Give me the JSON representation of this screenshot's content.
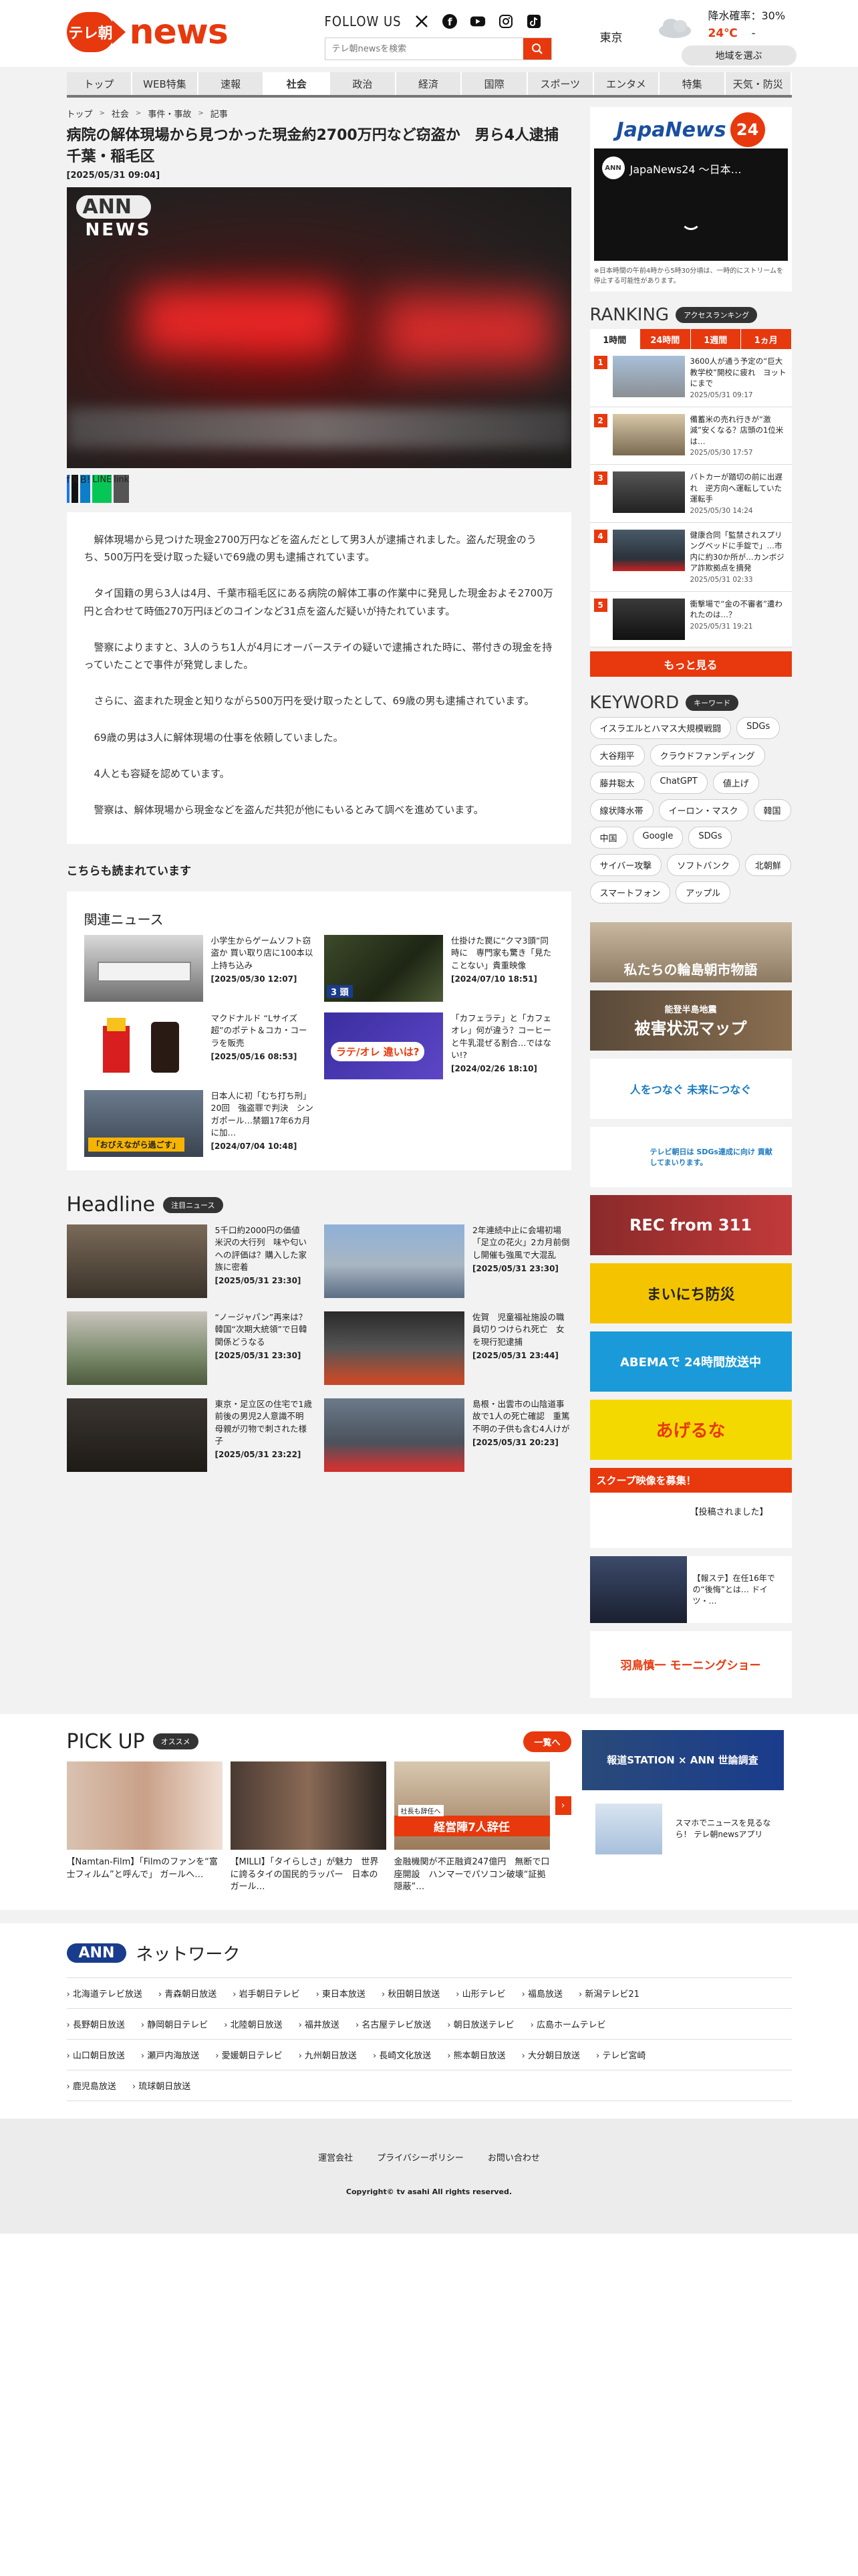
{
  "brand": {
    "logo_badge": "テレ朝",
    "logo_word": "news"
  },
  "follow": {
    "label": "FOLLOW US",
    "icons": [
      "x-icon",
      "facebook-icon",
      "youtube-icon",
      "instagram-icon",
      "tiktok-icon"
    ]
  },
  "search": {
    "placeholder": "テレ朝newsを検索"
  },
  "weather": {
    "city": "東京",
    "rain": "降水確率：30%",
    "temp_high": "24℃",
    "temp_low": "-",
    "region_button": "地域を選ぶ"
  },
  "nav": [
    "トップ",
    "WEB特集",
    "速報",
    "社会",
    "政治",
    "経済",
    "国際",
    "スポーツ",
    "エンタメ",
    "特集",
    "天気・防災"
  ],
  "nav_active": "社会",
  "breadcrumb": [
    "トップ",
    "社会",
    "事件・事故",
    "記事"
  ],
  "article": {
    "title": "病院の解体現場から見つかった現金約2700万円など窃盗か　男ら4人逮捕　千葉・稲毛区",
    "date": "[2025/05/31 09:04]",
    "video_ann_top": "ANN",
    "video_ann_bottom": "NEWS",
    "paragraphs": [
      "解体現場から見つけた現金2700万円などを盗んだとして男3人が逮捕されました。盗んだ現金のうち、500万円を受け取った疑いで69歳の男も逮捕されています。",
      "タイ国籍の男ら3人は4月、千葉市稲毛区にある病院の解体工事の作業中に発見した現金およそ2700万円と合わせて時価270万円ほどのコインなど31点を盗んだ疑いが持たれています。",
      "警察によりますと、3人のうち1人が4月にオーバーステイの疑いで逮捕された時に、帯付きの現金を持っていたことで事件が発覚しました。",
      "さらに、盗まれた現金と知りながら500万円を受け取ったとして、69歳の男も逮捕されています。",
      "69歳の男は3人に解体現場の仕事を依頼していました。",
      "4人とも容疑を認めています。",
      "警察は、解体現場から現金などを盗んだ共犯が他にもいるとみて調べを進めています。"
    ]
  },
  "share": [
    "f",
    "X",
    "B!",
    "LINE",
    "link"
  ],
  "more_read": "こちらも読まれています",
  "related": {
    "title": "関連ニュース",
    "items": [
      {
        "text": "小学生からゲームソフト窃盗か 買い取り店に100本以上持ち込み",
        "date": "[2025/05/30 12:07]"
      },
      {
        "text": "仕掛けた罠に“クマ3頭”同時に　専門家も驚き「見たことない」貴重映像",
        "date": "[2024/07/10 18:51]"
      },
      {
        "text": "マクドナルド “Lサイズ超”のポテト＆コカ・コーラを販売",
        "date": "[2025/05/16 08:53]"
      },
      {
        "text": "「カフェラテ」と「カフェオレ」何が違う？コーヒーと牛乳混ぜる割合…ではない!?",
        "date": "[2024/02/26 18:10]"
      },
      {
        "text": "日本人に初「むち打ち刑」20回　強盗罪で判決　シンガポール…禁錮17年6カ月に加…",
        "date": "[2024/07/04 10:48]"
      }
    ],
    "thumb_caption_4": "ラテ/オレ 違いは?",
    "thumb_caption_5": "「おびえながら過ごす」"
  },
  "headline": {
    "title": "Headline",
    "pill": "注目ニュース",
    "items": [
      {
        "text": "5千口約2000円の価値　米沢の大行列　味や匂いへの評価は？購入した家族に密着",
        "date": "[2025/05/31 23:30]"
      },
      {
        "text": "2年連続中止に会場初場　「足立の花火」2カ月前倒し開催も強風で大混乱",
        "date": "[2025/05/31 23:30]"
      },
      {
        "text": "“ノージャパン”再来は？韓国“次期大統領”で日韓関係どうなる",
        "date": "[2025/05/31 23:30]"
      },
      {
        "text": "佐賀　児童福祉施設の職員切りつけられ死亡　女を現行犯逮捕",
        "date": "[2025/05/31 23:44]"
      },
      {
        "text": "東京・足立区の住宅で1歳前後の男児2人意識不明　母親が刃物で刺された様子",
        "date": "[2025/05/31 23:22]"
      },
      {
        "text": "島根・出雲市の山陰道事故で1人の死亡確認　重篤不明の子供も含む4人けが",
        "date": "[2025/05/31 20:23]"
      }
    ]
  },
  "pickup": {
    "title": "PICK UP",
    "pill": "オススメ",
    "more": "一覧へ",
    "items": [
      {
        "text": "【Namtan-Film】「Filmのファンを“富士フィルム”と呼んで」 ガールへ…"
      },
      {
        "text": "【MILLI】「タイらしさ」が魅力　世界に誇るタイの国民的ラッパー　日本のガール…"
      },
      {
        "text": "金融機関が不正融資247億円　無断で口座開設　ハンマーでパソコン破壊“証拠隠蔽”…"
      }
    ],
    "thumb_caption_3": "経営陣7人辞任",
    "thumb_caption_3_small": "社長も辞任へ"
  },
  "sidebar": {
    "jn24_logo_text": "JapaNews",
    "jn24_logo_num": "24",
    "jn24_player_title": "JapaNews24 ～日本…",
    "jn24_player_badge": "ANN",
    "jn24_note": "※日本時間の午前4時から5時30分頃は、一時的にストリームを停止する可能性があります。",
    "ranking_title": "RANKING",
    "ranking_pill": "アクセスランキング",
    "ranking_tabs": [
      "1時間",
      "24時間",
      "1週間",
      "1ヵ月"
    ],
    "ranking_items": [
      {
        "num": "1",
        "text": "3600人が通う予定の“巨大教学校”開校に疲れ　ヨットにまで",
        "date": "2025/05/31 09:17"
      },
      {
        "num": "2",
        "text": "備蓄米の売れ行きが“激減”安くなる？店頭の1位米は…",
        "date": "2025/05/30 17:57"
      },
      {
        "num": "3",
        "text": "バトカーが踏切の前に出遅れ　逆方向へ運転していた運転手",
        "date": "2025/05/30 14:24"
      },
      {
        "num": "4",
        "text": "健康合同「監禁されスプリングベッドに手錠で」…市内に約30か所が…カンボジア詐欺拠点を摘発",
        "date": "2025/05/31 02:33"
      },
      {
        "num": "5",
        "text": "衝撃場で“金の不審者”遭われたのは…？",
        "date": "2025/05/31 19:21"
      }
    ],
    "ranking_more": "もっと見る",
    "keyword_title": "KEYWORD",
    "keyword_pill": "キーワード",
    "keywords": [
      "イスラエルとハマス大規模戦闘",
      "SDGs",
      "大谷翔平",
      "クラウドファンディング",
      "藤井聡太",
      "ChatGPT",
      "値上げ",
      "線状降水帯",
      "イーロン・マスク",
      "韓国",
      "中国",
      "Google",
      "SDGs",
      "サイバー攻撃",
      "ソフトバンク",
      "北朝鮮",
      "スマートフォン",
      "アップル"
    ],
    "banners": [
      {
        "name": "wajima-banner",
        "text": "私たちの輪島朝市物語"
      },
      {
        "name": "noto-banner",
        "sub": "能登半島地震",
        "text": "被害状況マップ"
      },
      {
        "name": "sdgs-banner",
        "text": "人をつなぐ 未来につなぐ"
      },
      {
        "name": "sdgs2-banner",
        "text": "テレビ朝日は SDGs達成に向け 貢献してまいります。"
      },
      {
        "name": "rec-banner",
        "text": "REC from 311"
      },
      {
        "name": "bousai-banner",
        "text": "まいにち防災"
      },
      {
        "name": "abema-banner",
        "text": "ABEMAで 24時間放送中"
      },
      {
        "name": "ageruna-banner",
        "text": "あげるな"
      },
      {
        "name": "scoop-banner",
        "text": "スクープ映像を募集！",
        "sub": "【投稿されました】"
      },
      {
        "name": "hodo-banner",
        "text": "【報ステ】在任16年での“後悔”とは… ドイツ・…"
      },
      {
        "name": "morning-banner",
        "text": "羽鳥慎一 モーニングショー"
      },
      {
        "name": "poll-banner",
        "text": "報道STATION × ANN 世論調査"
      },
      {
        "name": "app-banner",
        "text": "スマホでニュースを見るなら！ テレ朝newsアプリ"
      }
    ]
  },
  "network": {
    "logo": "ANN",
    "title": "ネットワーク",
    "rows": [
      [
        "北海道テレビ放送",
        "青森朝日放送",
        "岩手朝日テレビ",
        "東日本放送",
        "秋田朝日放送",
        "山形テレビ",
        "福島放送",
        "新潟テレビ21"
      ],
      [
        "長野朝日放送",
        "静岡朝日テレビ",
        "北陸朝日放送",
        "福井放送",
        "名古屋テレビ放送",
        "朝日放送テレビ",
        "広島ホームテレビ"
      ],
      [
        "山口朝日放送",
        "瀬戸内海放送",
        "愛媛朝日テレビ",
        "九州朝日放送",
        "長崎文化放送",
        "熊本朝日放送",
        "大分朝日放送",
        "テレビ宮崎"
      ],
      [
        "鹿児島放送",
        "琉球朝日放送"
      ]
    ]
  },
  "footer": {
    "links": [
      "運営会社",
      "プライバシーポリシー",
      "お問い合わせ"
    ],
    "copyright": "Copyright© tv asahi All rights reserved."
  },
  "colors": {
    "accent": "#e8380d",
    "nav_bg": "#e7e7e7",
    "page_bg": "#f2f2f2"
  }
}
